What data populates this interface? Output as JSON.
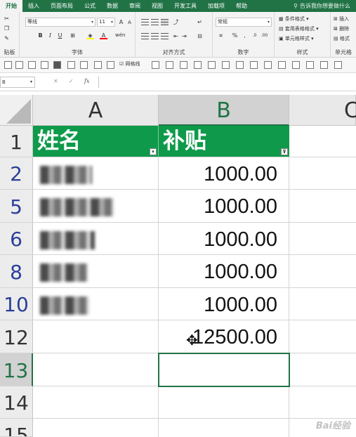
{
  "ribbon_tabs": [
    "开始",
    "插入",
    "页面布局",
    "公式",
    "数据",
    "审阅",
    "视图",
    "开发工具",
    "加载项",
    "帮助"
  ],
  "tell_me": "告诉我你想要做什么",
  "ribbon": {
    "font_name": "等线",
    "font_size": "11",
    "number_format": "常规",
    "bold": "B",
    "italic": "I",
    "underline": "U",
    "font_color_letter": "A",
    "wen": "wén",
    "percent": "%",
    "comma": ",",
    "groups": {
      "clipboard": "贴板",
      "font": "字体",
      "alignment": "对齐方式",
      "number": "数字",
      "styles": "样式",
      "cells": "单元格"
    },
    "styles_items": [
      "条件格式",
      "套用表格格式",
      "单元格样式"
    ],
    "cells_items": [
      "插入",
      "删除",
      "格式"
    ]
  },
  "qat": {
    "gridlines_label": "网格线"
  },
  "formula_bar": {
    "name_box": "B",
    "cancel": "✕",
    "confirm": "✓",
    "fx": "fx",
    "formula": ""
  },
  "columns": [
    "A",
    "B",
    "C"
  ],
  "rows": [
    {
      "num": "1",
      "a": "姓名",
      "b": "补贴",
      "header": true
    },
    {
      "num": "2",
      "a": "",
      "b": "1000.00"
    },
    {
      "num": "5",
      "a": "",
      "b": "1000.00"
    },
    {
      "num": "6",
      "a": "",
      "b": "1000.00"
    },
    {
      "num": "8",
      "a": "",
      "b": "1000.00"
    },
    {
      "num": "10",
      "a": "",
      "b": "1000.00"
    },
    {
      "num": "12",
      "a": "",
      "b": "12500.00"
    },
    {
      "num": "13",
      "a": "",
      "b": ""
    },
    {
      "num": "14",
      "a": "",
      "b": ""
    },
    {
      "num": "15",
      "a": "",
      "b": ""
    }
  ],
  "watermark": "Bai经验",
  "colors": {
    "excel_green": "#217346",
    "header_fill": "#0e9a4a",
    "row_number_blue": "#2a3f9a"
  }
}
